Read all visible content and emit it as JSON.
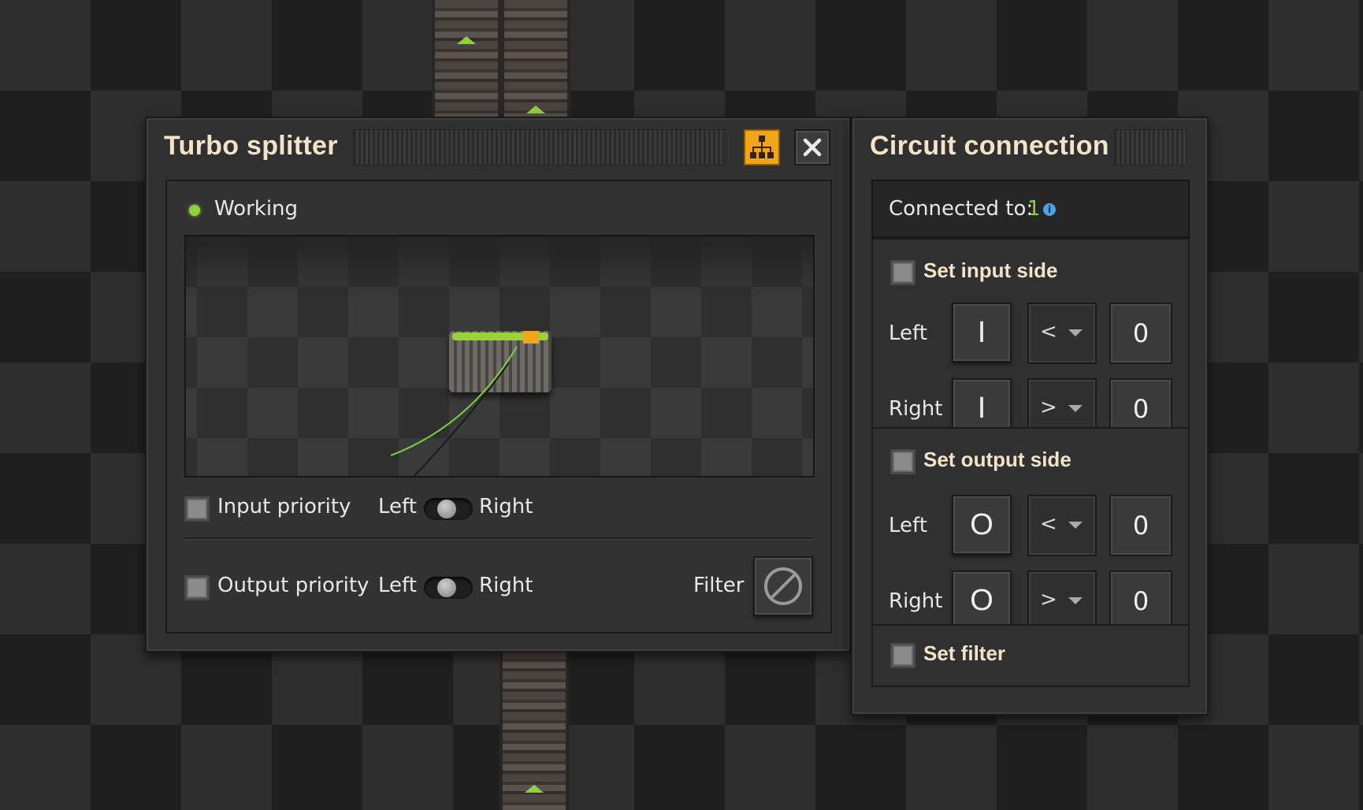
{
  "splitter": {
    "title": "Turbo splitter",
    "status": "Working",
    "status_color": "#8fd13b",
    "accent": "#f0a419",
    "input_priority": {
      "label": "Input priority",
      "left": "Left",
      "right": "Right"
    },
    "output_priority": {
      "label": "Output priority",
      "left": "Left",
      "right": "Right"
    },
    "filter_label": "Filter",
    "network_icon": "circuit-network-icon",
    "close_icon": "close-icon",
    "filter_icon": "no-filter-icon"
  },
  "circuit": {
    "title": "Circuit connection",
    "connected_label": "Connected to:",
    "connected_count": "1",
    "input_side": {
      "label": "Set input side",
      "rows": [
        {
          "side": "Left",
          "signal": "I",
          "op": "<",
          "value": "0"
        },
        {
          "side": "Right",
          "signal": "I",
          "op": ">",
          "value": "0"
        }
      ]
    },
    "output_side": {
      "label": "Set output side",
      "rows": [
        {
          "side": "Left",
          "signal": "O",
          "op": "<",
          "value": "0"
        },
        {
          "side": "Right",
          "signal": "O",
          "op": ">",
          "value": "0"
        }
      ]
    },
    "set_filter": "Set filter"
  }
}
